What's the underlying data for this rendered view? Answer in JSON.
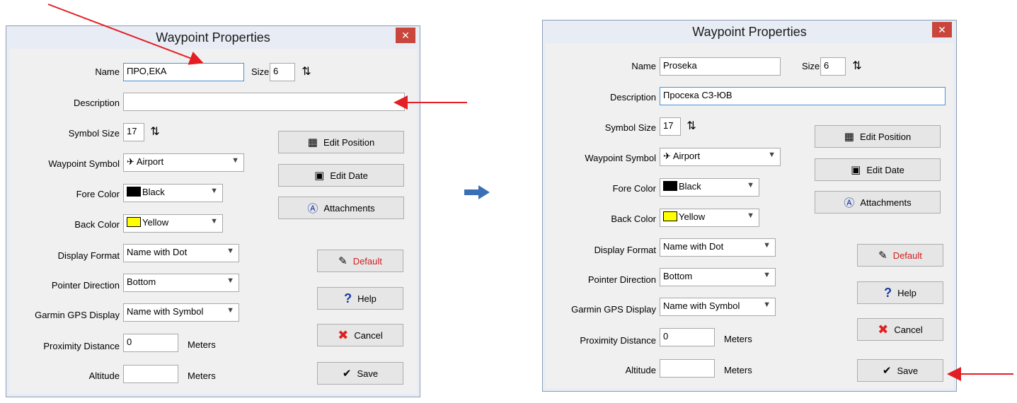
{
  "dialogs": [
    {
      "title": "Waypoint Properties",
      "name_label": "Name",
      "name_value": "ПРО,ЕКА",
      "size_label": "Size",
      "size_value": "6",
      "description_label": "Description",
      "description_value": "",
      "symbol_size_label": "Symbol Size",
      "symbol_size_value": "17",
      "waypoint_symbol_label": "Waypoint Symbol",
      "waypoint_symbol_value": "Airport",
      "fore_color_label": "Fore Color",
      "fore_color_value": "Black",
      "back_color_label": "Back Color",
      "back_color_value": "Yellow",
      "display_format_label": "Display Format",
      "display_format_value": "Name with Dot",
      "pointer_direction_label": "Pointer Direction",
      "pointer_direction_value": "Bottom",
      "garmin_label": "Garmin GPS Display",
      "garmin_value": "Name with Symbol",
      "proximity_label": "Proximity Distance",
      "proximity_value": "0",
      "altitude_label": "Altitude",
      "altitude_value": "",
      "meters_label": "Meters",
      "edit_position": "Edit Position",
      "edit_date": "Edit Date",
      "attachments": "Attachments",
      "default": "Default",
      "help": "Help",
      "cancel": "Cancel",
      "save": "Save"
    },
    {
      "title": "Waypoint Properties",
      "name_label": "Name",
      "name_value": "Proseka",
      "size_label": "Size",
      "size_value": "6",
      "description_label": "Description",
      "description_value": "Просека СЗ-ЮВ",
      "symbol_size_label": "Symbol Size",
      "symbol_size_value": "17",
      "waypoint_symbol_label": "Waypoint Symbol",
      "waypoint_symbol_value": "Airport",
      "fore_color_label": "Fore Color",
      "fore_color_value": "Black",
      "back_color_label": "Back Color",
      "back_color_value": "Yellow",
      "display_format_label": "Display Format",
      "display_format_value": "Name with Dot",
      "pointer_direction_label": "Pointer Direction",
      "pointer_direction_value": "Bottom",
      "garmin_label": "Garmin GPS Display",
      "garmin_value": "Name with Symbol",
      "proximity_label": "Proximity Distance",
      "proximity_value": "0",
      "altitude_label": "Altitude",
      "altitude_value": "",
      "meters_label": "Meters",
      "edit_position": "Edit Position",
      "edit_date": "Edit Date",
      "attachments": "Attachments",
      "default": "Default",
      "help": "Help",
      "cancel": "Cancel",
      "save": "Save"
    }
  ],
  "colors": {
    "annotation_arrow": "#e31e24",
    "transition_arrow": "#3a6fb5",
    "fore_swatch": "#000000",
    "back_swatch": "#ffff00",
    "default_text": "#d02020",
    "cancel_icon": "#e02020",
    "help_icon": "#1a3a9c"
  },
  "icons": {
    "edit_position": "table-edit-icon",
    "edit_date": "calendar-icon",
    "attachments": "document-a-icon",
    "default": "wand-icon",
    "help": "question-icon",
    "cancel": "x-icon",
    "save": "save-check-icon",
    "spinner": "spinner-icon",
    "airport": "airplane-icon"
  }
}
